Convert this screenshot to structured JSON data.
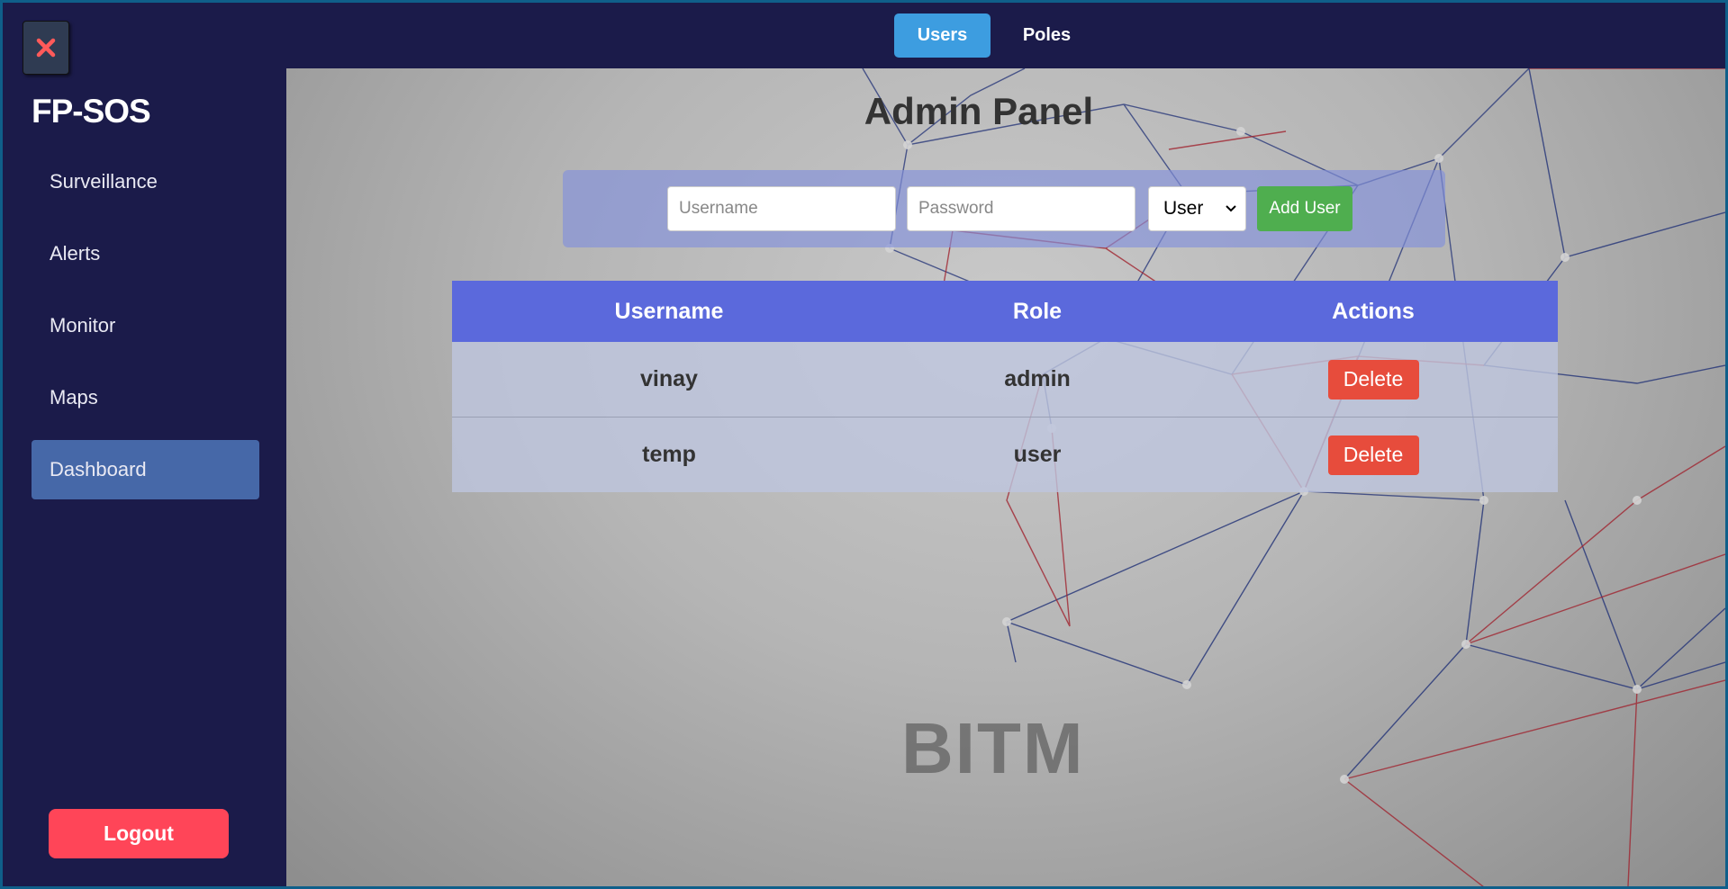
{
  "sidebar": {
    "brand": "FP-SOS",
    "items": [
      {
        "label": "Surveillance",
        "active": false
      },
      {
        "label": "Alerts",
        "active": false
      },
      {
        "label": "Monitor",
        "active": false
      },
      {
        "label": "Maps",
        "active": false
      },
      {
        "label": "Dashboard",
        "active": true
      }
    ],
    "logout_label": "Logout"
  },
  "topbar": {
    "tabs": [
      {
        "label": "Users",
        "active": true
      },
      {
        "label": "Poles",
        "active": false
      }
    ]
  },
  "main": {
    "title": "Admin Panel",
    "form": {
      "username_placeholder": "Username",
      "password_placeholder": "Password",
      "role_selected": "User",
      "add_label": "Add User"
    },
    "table": {
      "headers": [
        "Username",
        "Role",
        "Actions"
      ],
      "rows": [
        {
          "username": "vinay",
          "role": "admin",
          "action": "Delete"
        },
        {
          "username": "temp",
          "role": "user",
          "action": "Delete"
        }
      ]
    },
    "watermark": "BITM"
  },
  "colors": {
    "sidebar_bg": "#1b1b4a",
    "active_nav": "#4668a8",
    "active_tab": "#3d9de0",
    "table_header": "#5b69dc",
    "delete": "#e74c3c",
    "add": "#4fae4f",
    "logout": "#ff4558"
  }
}
